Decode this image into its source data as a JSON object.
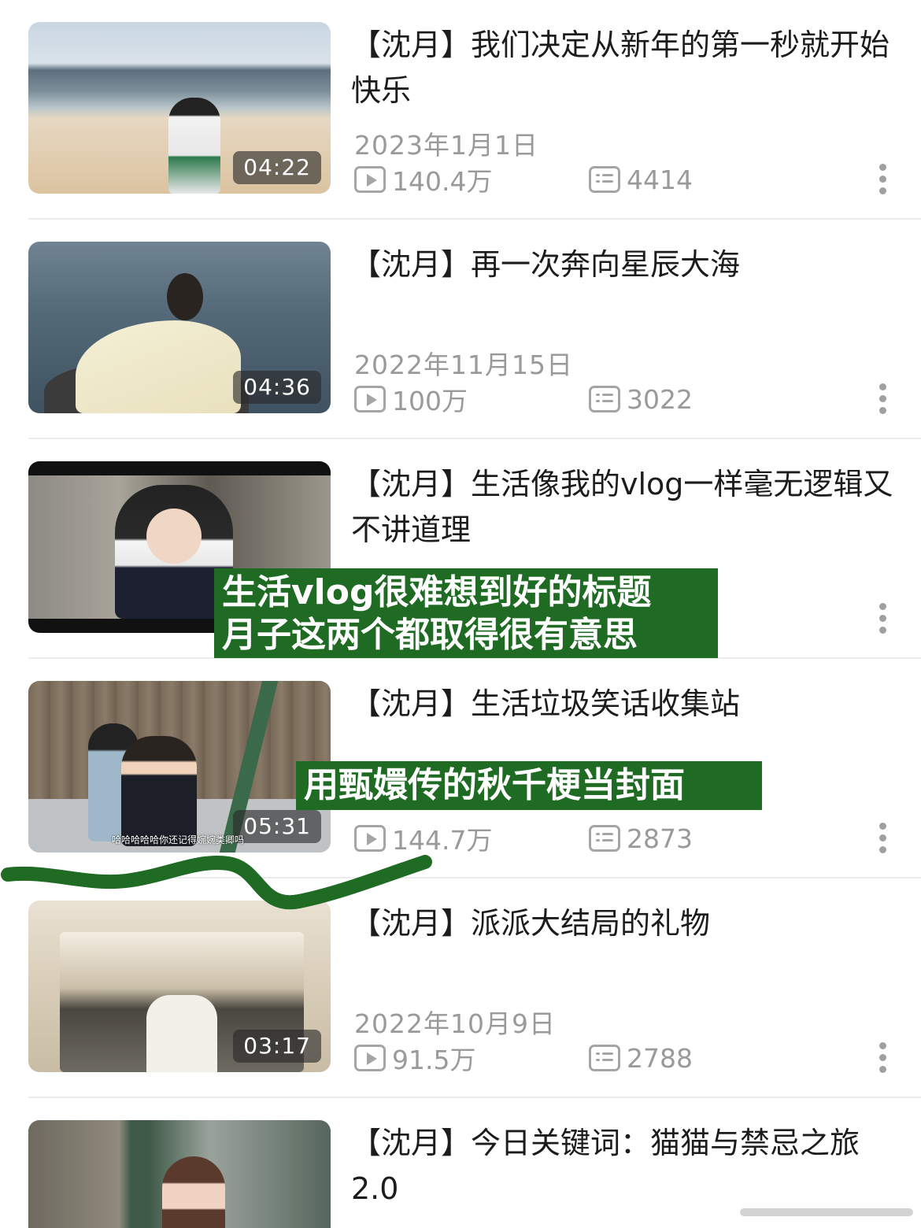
{
  "videos": [
    {
      "title": "【沈月】我们决定从新年的第一秒就开始快乐",
      "date": "2023年1月1日",
      "plays": "140.4万",
      "comments": "4414",
      "duration": "04:22"
    },
    {
      "title": "【沈月】再一次奔向星辰大海",
      "date": "2022年11月15日",
      "plays": "100万",
      "comments": "3022",
      "duration": "04:36"
    },
    {
      "title": "【沈月】生活像我的vlog一样毫无逻辑又不讲道理",
      "date": "",
      "plays": "",
      "comments": "",
      "duration": ""
    },
    {
      "title": "【沈月】生活垃圾笑话收集站",
      "date": "",
      "plays": "144.7万",
      "comments": "2873",
      "duration": "05:31",
      "caption": "哈哈哈哈哈你还记得婉婉类卿吗"
    },
    {
      "title": "【沈月】派派大结局的礼物",
      "date": "2022年10月9日",
      "plays": "91.5万",
      "comments": "2788",
      "duration": "03:17"
    },
    {
      "title": "【沈月】今日关键词：猫猫与禁忌之旅2.0",
      "date": "",
      "plays": "",
      "comments": "",
      "duration": ""
    }
  ],
  "annotations": [
    {
      "line1": "生活vlog很难想到好的标题",
      "line2": "月子这两个都取得很有意思"
    },
    {
      "line1": "用甄嬛传的秋千梗当封面"
    }
  ],
  "colors": {
    "annotation_bg": "#1f6b24",
    "meta_text": "#9a9a9a",
    "title_text": "#1c1c1c"
  },
  "icons": [
    "play-count-icon",
    "danmaku-icon",
    "more-icon"
  ]
}
